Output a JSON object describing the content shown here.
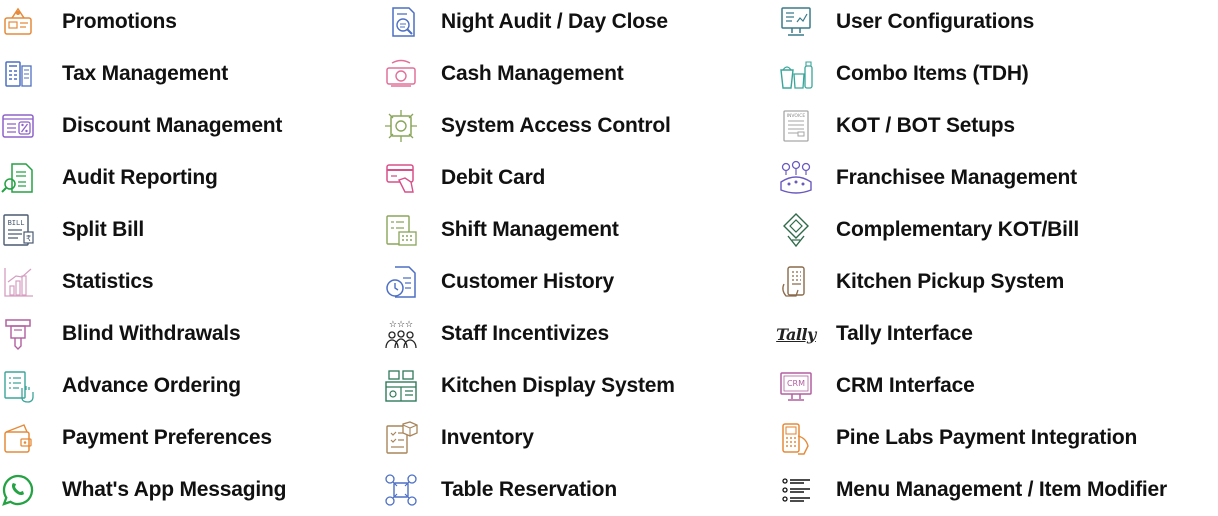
{
  "columns": [
    {
      "items": [
        {
          "label": "Promotions",
          "icon": "promotions-icon"
        },
        {
          "label": "Tax Management",
          "icon": "tax-calculator-icon"
        },
        {
          "label": "Discount Management",
          "icon": "discount-screen-icon"
        },
        {
          "label": "Audit Reporting",
          "icon": "audit-report-icon"
        },
        {
          "label": "Split Bill",
          "icon": "bill-icon"
        },
        {
          "label": "Statistics",
          "icon": "statistics-chart-icon"
        },
        {
          "label": "Blind Withdrawals",
          "icon": "withdrawal-atm-icon"
        },
        {
          "label": "Advance Ordering",
          "icon": "advance-order-icon"
        },
        {
          "label": "Payment Preferences",
          "icon": "wallet-icon"
        },
        {
          "label": "What's App Messaging",
          "icon": "whatsapp-icon"
        }
      ]
    },
    {
      "items": [
        {
          "label": "Night Audit / Day Close",
          "icon": "night-audit-icon"
        },
        {
          "label": "Cash Management",
          "icon": "cash-icon"
        },
        {
          "label": "System Access Control",
          "icon": "access-control-icon"
        },
        {
          "label": "Debit Card",
          "icon": "debit-card-icon"
        },
        {
          "label": "Shift Management",
          "icon": "shift-calendar-icon"
        },
        {
          "label": "Customer History",
          "icon": "customer-history-icon"
        },
        {
          "label": "Staff Incentivizes",
          "icon": "staff-stars-icon"
        },
        {
          "label": "Kitchen Display System",
          "icon": "kitchen-display-icon"
        },
        {
          "label": "Inventory",
          "icon": "inventory-icon"
        },
        {
          "label": "Table Reservation",
          "icon": "table-reservation-icon"
        }
      ]
    },
    {
      "items": [
        {
          "label": "User Configurations",
          "icon": "user-config-monitor-icon"
        },
        {
          "label": "Combo Items (TDH)",
          "icon": "combo-items-icon"
        },
        {
          "label": "KOT / BOT Setups",
          "icon": "invoice-icon"
        },
        {
          "label": "Franchisee Management",
          "icon": "franchisee-icon"
        },
        {
          "label": "Complementary KOT/Bill",
          "icon": "complementary-icon"
        },
        {
          "label": "Kitchen Pickup System",
          "icon": "kitchen-pickup-phone-icon"
        },
        {
          "label": "Tally Interface",
          "icon": "tally-logo-icon",
          "logo_text": "Tally"
        },
        {
          "label": "CRM Interface",
          "icon": "crm-monitor-icon",
          "logo_text": "CRM"
        },
        {
          "label": "Pine Labs Payment Integration",
          "icon": "pine-labs-pos-icon"
        },
        {
          "label": "Menu Management / Item Modifier",
          "icon": "menu-list-icon"
        }
      ]
    }
  ],
  "colors": {
    "text": "#111111",
    "green": "#25a244",
    "pink": "#e0709a",
    "purple": "#8d62c9",
    "blue": "#4d6fc4",
    "orange": "#e58a3a",
    "olive": "#8aa55a",
    "gray": "#8a8a8a",
    "teal": "#3aa59a"
  }
}
